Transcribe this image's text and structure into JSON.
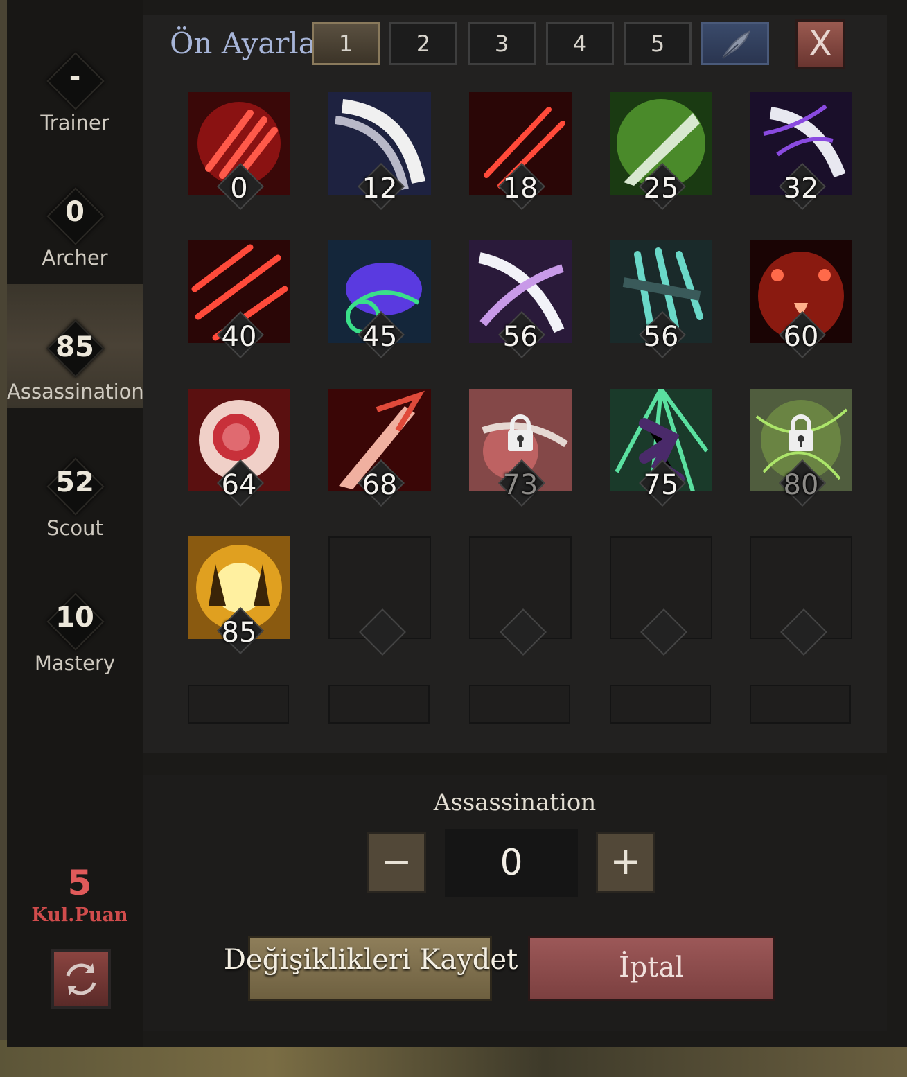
{
  "window": {
    "title": "Ön Ayarlar"
  },
  "presets": {
    "tabs": [
      "1",
      "2",
      "3",
      "4",
      "5"
    ],
    "active": "1",
    "edit_icon": "feather-icon",
    "close_label": "X"
  },
  "categories": [
    {
      "value": "-",
      "name": "Trainer"
    },
    {
      "value": "0",
      "name": "Archer"
    },
    {
      "value": "85",
      "name": "Assassination"
    },
    {
      "value": "52",
      "name": "Scout"
    },
    {
      "value": "10",
      "name": "Mastery"
    }
  ],
  "active_category": "Assassination",
  "skills": [
    {
      "level": "0",
      "icon": "red-claw-slash-icon",
      "locked": false
    },
    {
      "level": "12",
      "icon": "white-blade-sweep-icon",
      "locked": false
    },
    {
      "level": "18",
      "icon": "red-double-slash-icon",
      "locked": false
    },
    {
      "level": "25",
      "icon": "green-dagger-icon",
      "locked": false
    },
    {
      "level": "32",
      "icon": "purple-blade-icon",
      "locked": false
    },
    {
      "level": "40",
      "icon": "red-triple-slash-icon",
      "locked": false
    },
    {
      "level": "45",
      "icon": "chameleon-icon",
      "locked": false
    },
    {
      "level": "56",
      "icon": "purple-cross-slash-icon",
      "locked": false
    },
    {
      "level": "56",
      "icon": "teal-claw-icon",
      "locked": false
    },
    {
      "level": "60",
      "icon": "red-demon-face-icon",
      "locked": false
    },
    {
      "level": "64",
      "icon": "blood-orb-icon",
      "locked": false
    },
    {
      "level": "68",
      "icon": "red-dagger-icon",
      "locked": false
    },
    {
      "level": "73",
      "icon": "bloody-strike-icon",
      "locked": true
    },
    {
      "level": "75",
      "icon": "leaping-assassin-icon",
      "locked": false
    },
    {
      "level": "80",
      "icon": "green-poison-icon",
      "locked": true
    },
    {
      "level": "85",
      "icon": "golden-burst-icon",
      "locked": false
    }
  ],
  "allocation": {
    "title": "Assassination",
    "value": "0",
    "minus_label": "−",
    "plus_label": "+"
  },
  "actions": {
    "save_label": "Değişiklikleri Kaydet",
    "cancel_label": "İptal"
  },
  "points": {
    "value": "5",
    "label": "Kul.Puan",
    "reset_icon": "refresh-icon"
  },
  "colors": {
    "accent_gold": "#8e7e5a",
    "cancel_red": "#9c5858",
    "points_red": "#e05a5a",
    "title_blue": "#a7b5d8"
  }
}
